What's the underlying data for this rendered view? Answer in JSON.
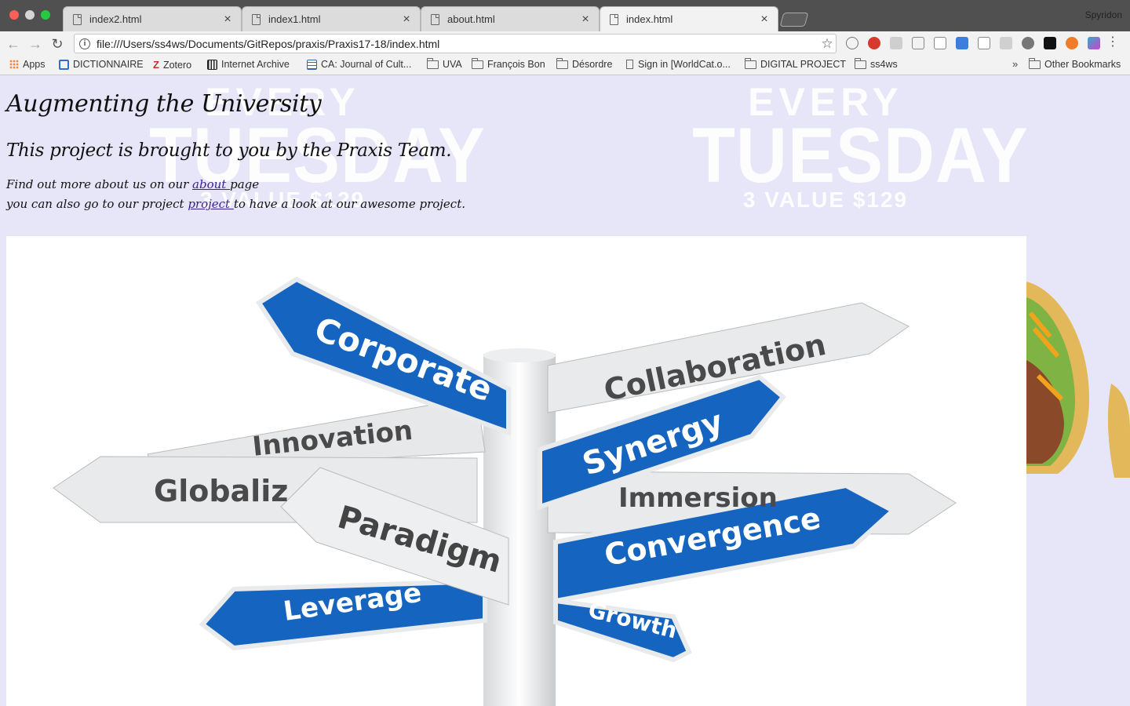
{
  "browser": {
    "tabs": [
      {
        "label": "index2.html",
        "close": "×"
      },
      {
        "label": "index1.html",
        "close": "×"
      },
      {
        "label": "about.html",
        "close": "×"
      },
      {
        "label": "index.html",
        "close": "×",
        "active": true
      }
    ],
    "profile": "Spyridon",
    "address": "file:///Users/ss4ws/Documents/GitRepos/praxis/Praxis17-18/index.html",
    "bookmarks": [
      {
        "label": "Apps",
        "icon": "apps-grid-icon"
      },
      {
        "label": "DICTIONNAIRE",
        "icon": "dictionary-icon"
      },
      {
        "label": "Zotero",
        "icon": "zotero-icon"
      },
      {
        "label": "Internet Archive",
        "icon": "archive-icon"
      },
      {
        "label": "CA: Journal of Cult...",
        "icon": "journal-icon"
      },
      {
        "label": "UVA",
        "icon": "folder-icon"
      },
      {
        "label": "François Bon",
        "icon": "folder-icon"
      },
      {
        "label": "Désordre",
        "icon": "folder-icon"
      },
      {
        "label": "Sign in [WorldCat.o...",
        "icon": "page-icon"
      },
      {
        "label": "DIGITAL PROJECT",
        "icon": "folder-icon"
      },
      {
        "label": "ss4ws",
        "icon": "folder-icon"
      }
    ],
    "overflow": "»",
    "other_bookmarks": "Other Bookmarks"
  },
  "page": {
    "title": "Augmenting the University",
    "subtitle": "This project is brought to you by the Praxis Team.",
    "line1_before": "Find out more about us on our ",
    "line1_link": "about ",
    "line1_after": "page",
    "line2_before": "you can also go to our project ",
    "line2_link": "project ",
    "line2_after": "to have a look at our awesome project."
  },
  "background_promo": {
    "every": "EVERY",
    "tuesday": "TUESDAY",
    "value": "3 VALUE $129"
  },
  "hero_signs": [
    "Corporate",
    "Collaboration",
    "Innovation",
    "Synergy",
    "Globaliz",
    "Immersion",
    "Paradigm",
    "Convergence",
    "Leverage",
    "Growth"
  ],
  "colors": {
    "page_bg": "#e6e6f8",
    "sign_blue": "#1565c0",
    "sign_white": "#e8eaec",
    "link": "#3b1f8f"
  }
}
